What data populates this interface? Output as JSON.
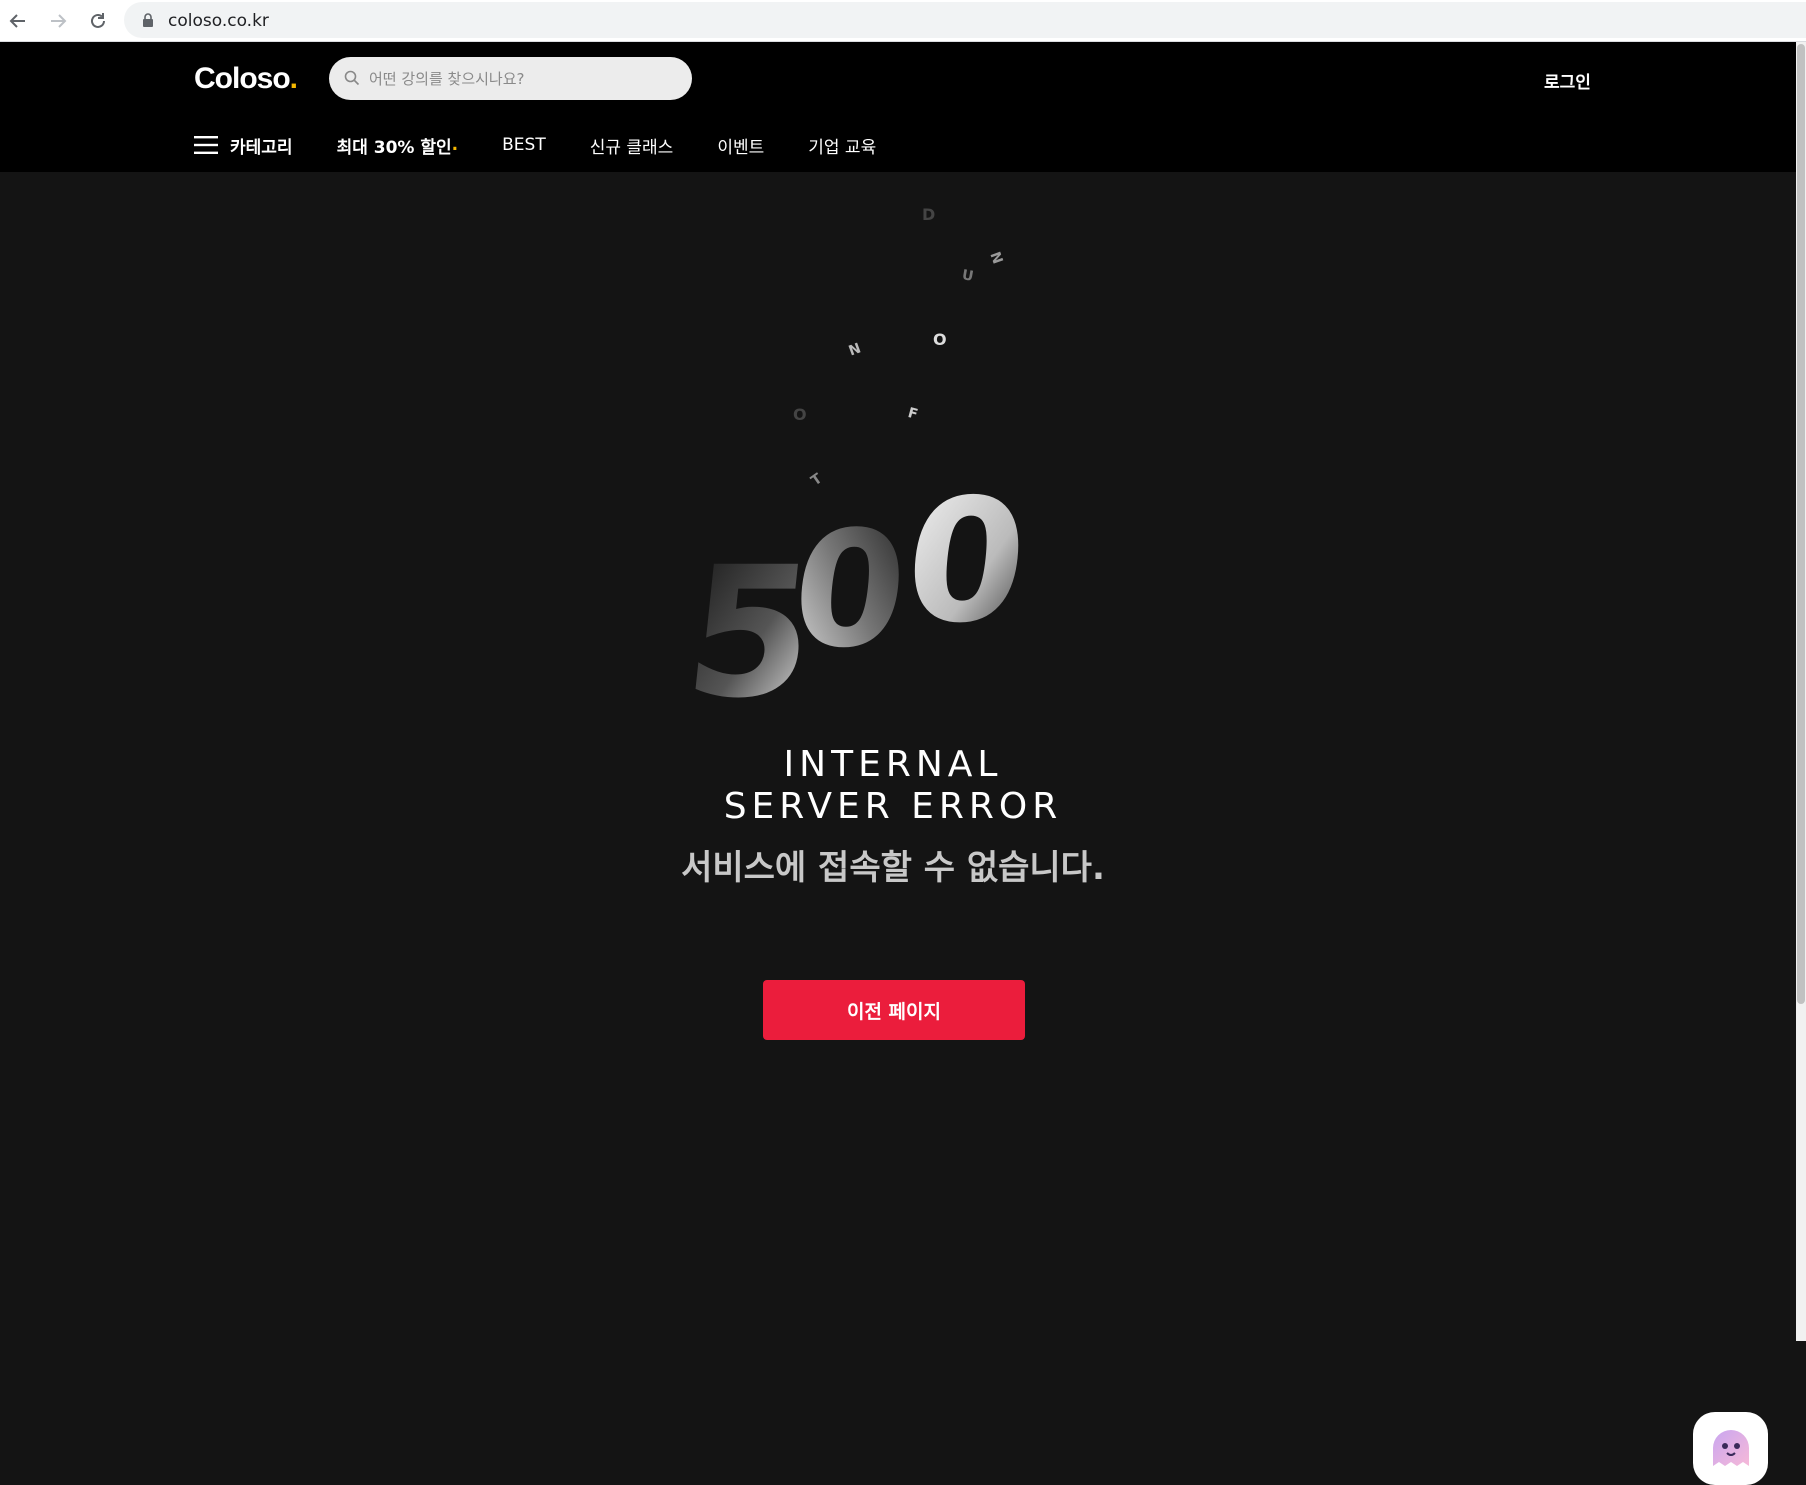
{
  "browser": {
    "url": "coloso.co.kr"
  },
  "header": {
    "logo_text": "Coloso",
    "logo_dot": ".",
    "search_placeholder": "어떤 강의를 찾으시나요?",
    "login_label": "로그인",
    "nav": {
      "category_label": "카테고리",
      "promo_label": "최대 30% 할인",
      "promo_dot": ".",
      "best_label": "BEST",
      "new_label": "신규 클래스",
      "event_label": "이벤트",
      "corporate_label": "기업 교육"
    }
  },
  "error": {
    "code": "500",
    "floating_letters": [
      "N",
      "O",
      "T",
      "F",
      "O",
      "U",
      "N",
      "D"
    ],
    "title_line1": "INTERNAL",
    "title_line2": "SERVER ERROR",
    "description": "서비스에 접속할 수 없습니다.",
    "back_button_label": "이전 페이지"
  },
  "colors": {
    "brand_accent": "#f5b800",
    "button_red": "#eb1d3c",
    "background": "#141414",
    "header_bg": "#000000"
  }
}
